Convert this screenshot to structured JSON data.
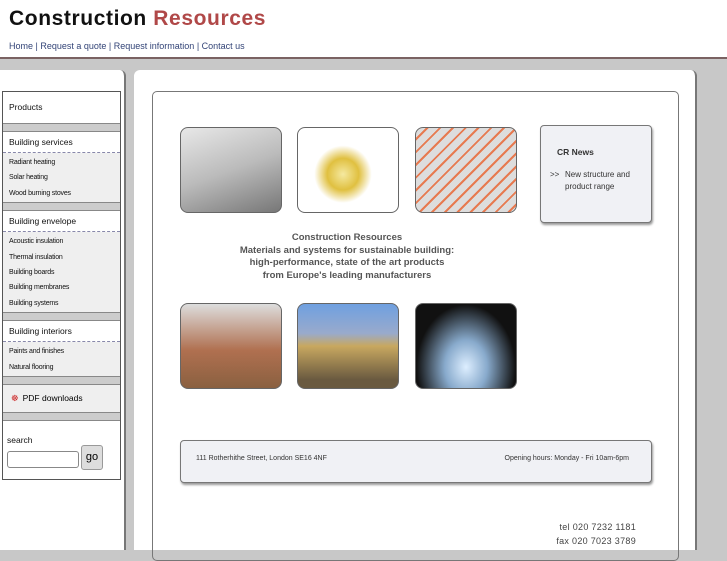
{
  "header": {
    "logo_part1": "Construction",
    "logo_part2": "Resources",
    "nav": [
      "Home",
      "Request a quote",
      "Request information",
      "Contact us"
    ]
  },
  "sidebar": {
    "products": "Products",
    "sections": [
      {
        "title": "Building services",
        "items": [
          "Radiant heating",
          "Solar heating",
          "Wood burning stoves"
        ]
      },
      {
        "title": "Building envelope",
        "items": [
          "Acoustic insulation",
          "Thermal insulation",
          "Building boards",
          "Building membranes",
          "Building systems"
        ]
      },
      {
        "title": "Building interiors",
        "items": [
          "Paints and finishes",
          "Natural flooring"
        ]
      }
    ],
    "pdf": "PDF downloads",
    "search_label": "search",
    "search_value": "",
    "go": "go"
  },
  "news": {
    "title": "CR News",
    "bullet": ">>",
    "line1": "New structure and",
    "line2": "product range"
  },
  "tagline": [
    "Construction Resources",
    "Materials and systems for sustainable building:",
    "high-performance, state of the art products",
    "from Europe's leading manufacturers"
  ],
  "footer": {
    "address": "111 Rotherhithe Street, London SE16 4NF",
    "hours": "Opening hours: Monday - Fri  10am-6pm"
  },
  "contact": {
    "tel": "tel  020 7232 1181",
    "fax": "fax  020 7023 3789"
  },
  "colors": {
    "accent": "#b04848",
    "nav": "#334477"
  }
}
